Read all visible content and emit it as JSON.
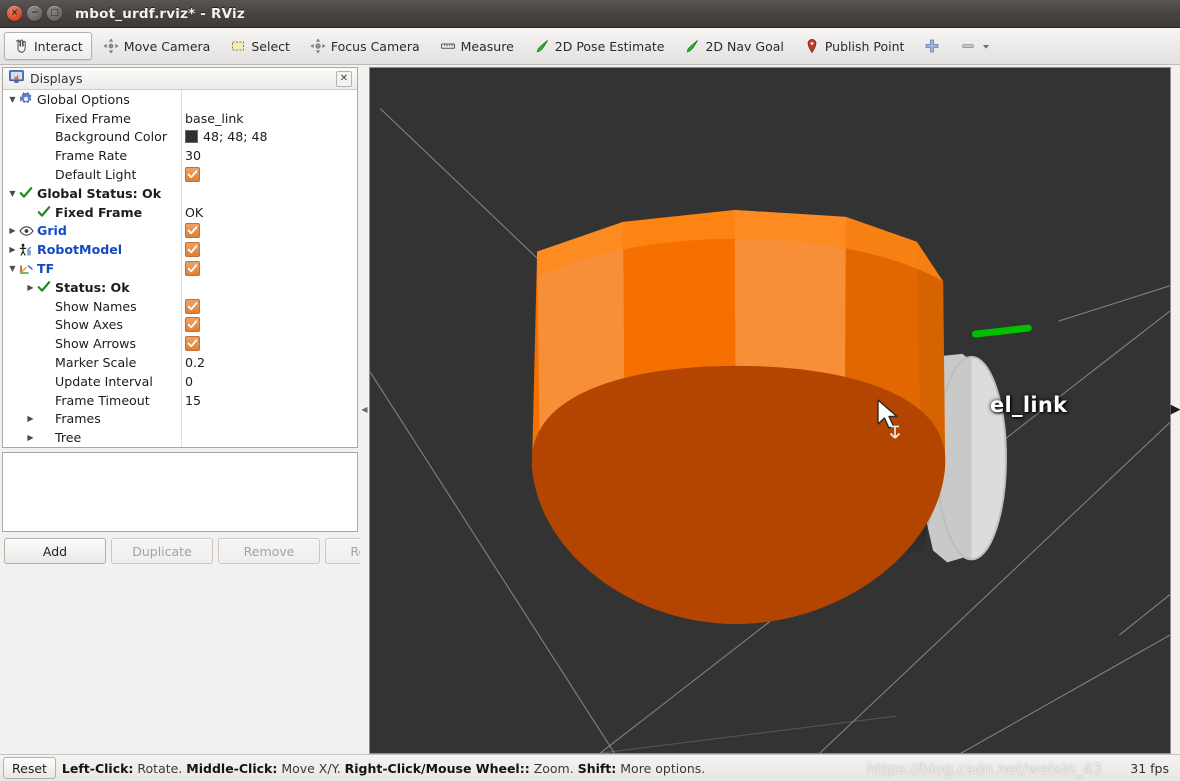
{
  "window": {
    "title": "mbot_urdf.rviz* - RViz",
    "controls": [
      {
        "name": "close",
        "glyph": "×"
      },
      {
        "name": "minimize",
        "glyph": "−"
      },
      {
        "name": "maximize",
        "glyph": "□"
      }
    ]
  },
  "toolbar": {
    "items": [
      {
        "label": "Interact",
        "icon": "hand-cursor-icon",
        "active": true
      },
      {
        "label": "Move Camera",
        "icon": "move-camera-icon",
        "active": false
      },
      {
        "label": "Select",
        "icon": "select-rect-icon",
        "active": false
      },
      {
        "label": "Focus Camera",
        "icon": "focus-camera-icon",
        "active": false
      },
      {
        "label": "Measure",
        "icon": "measure-ruler-icon",
        "active": false
      },
      {
        "label": "2D Pose Estimate",
        "icon": "pose-arrow-icon",
        "active": false
      },
      {
        "label": "2D Nav Goal",
        "icon": "nav-goal-arrow-icon",
        "active": false
      },
      {
        "label": "Publish Point",
        "icon": "map-pin-icon",
        "active": false
      }
    ],
    "add_tool_icon": "plus-icon",
    "remove_tool_icon": "minus-icon",
    "remove_tool_dropdown_icon": "chevron-down-icon"
  },
  "displays": {
    "panel_title": "Displays",
    "panel_icon": "monitor-icon",
    "close_glyph": "✕",
    "rows": [
      {
        "indent": 0,
        "twisty": "down",
        "icon": "gear-icon",
        "label": "Global Options",
        "style": "plain",
        "value_type": "none"
      },
      {
        "indent": 1,
        "twisty": "none",
        "icon": "none",
        "label": "Fixed Frame",
        "style": "plain",
        "value_type": "text",
        "value": "base_link"
      },
      {
        "indent": 1,
        "twisty": "none",
        "icon": "none",
        "label": "Background Color",
        "style": "plain",
        "value_type": "color",
        "value": "48; 48; 48",
        "swatch": "#303030"
      },
      {
        "indent": 1,
        "twisty": "none",
        "icon": "none",
        "label": "Frame Rate",
        "style": "plain",
        "value_type": "text",
        "value": "30"
      },
      {
        "indent": 1,
        "twisty": "none",
        "icon": "none",
        "label": "Default Light",
        "style": "plain",
        "value_type": "checkbox",
        "value": "checked"
      },
      {
        "indent": 0,
        "twisty": "down",
        "icon": "check-icon",
        "label": "Global Status: Ok",
        "style": "bold",
        "value_type": "none"
      },
      {
        "indent": 1,
        "twisty": "none",
        "icon": "check-icon",
        "label": "Fixed Frame",
        "style": "bold",
        "value_type": "text",
        "value": "OK"
      },
      {
        "indent": 0,
        "twisty": "right",
        "icon": "eye-icon",
        "label": "Grid",
        "style": "blue",
        "value_type": "checkbox",
        "value": "checked"
      },
      {
        "indent": 0,
        "twisty": "right",
        "icon": "robot-model-icon",
        "label": "RobotModel",
        "style": "blue",
        "value_type": "checkbox",
        "value": "checked"
      },
      {
        "indent": 0,
        "twisty": "down",
        "icon": "tf-axes-icon",
        "label": "TF",
        "style": "blue",
        "value_type": "checkbox",
        "value": "checked"
      },
      {
        "indent": 1,
        "twisty": "right",
        "icon": "check-icon",
        "label": "Status: Ok",
        "style": "bold",
        "value_type": "none"
      },
      {
        "indent": 1,
        "twisty": "none",
        "icon": "none",
        "label": "Show Names",
        "style": "plain",
        "value_type": "checkbox",
        "value": "checked"
      },
      {
        "indent": 1,
        "twisty": "none",
        "icon": "none",
        "label": "Show Axes",
        "style": "plain",
        "value_type": "checkbox",
        "value": "checked"
      },
      {
        "indent": 1,
        "twisty": "none",
        "icon": "none",
        "label": "Show Arrows",
        "style": "plain",
        "value_type": "checkbox",
        "value": "checked"
      },
      {
        "indent": 1,
        "twisty": "none",
        "icon": "none",
        "label": "Marker Scale",
        "style": "plain",
        "value_type": "text",
        "value": "0.2"
      },
      {
        "indent": 1,
        "twisty": "none",
        "icon": "none",
        "label": "Update Interval",
        "style": "plain",
        "value_type": "text",
        "value": "0"
      },
      {
        "indent": 1,
        "twisty": "none",
        "icon": "none",
        "label": "Frame Timeout",
        "style": "plain",
        "value_type": "text",
        "value": "15"
      },
      {
        "indent": 1,
        "twisty": "right",
        "icon": "none",
        "label": "Frames",
        "style": "plain",
        "value_type": "none"
      },
      {
        "indent": 1,
        "twisty": "right",
        "icon": "none",
        "label": "Tree",
        "style": "plain",
        "value_type": "none"
      }
    ],
    "buttons": [
      {
        "label": "Add",
        "enabled": true
      },
      {
        "label": "Duplicate",
        "enabled": false
      },
      {
        "label": "Remove",
        "enabled": false
      },
      {
        "label": "Rename",
        "enabled": false
      }
    ]
  },
  "view3d": {
    "background_color": "#333333",
    "grid_color": "#b9b9b9",
    "robot_body_color": "#f57000",
    "robot_body_shadow_color": "#b44500",
    "wheel_color": "#d6d6d6",
    "tf_label": "el_link",
    "tf_axis_color": "#00c000",
    "cursor_icon": "arrow-cursor-icon",
    "splitter_left_icon": "collapse-left-icon",
    "splitter_right_icon": "collapse-right-icon"
  },
  "statusbar": {
    "reset_label": "Reset",
    "hint_segments": [
      {
        "text": "Left-Click:",
        "bold": true
      },
      {
        "text": " Rotate. ",
        "bold": false
      },
      {
        "text": "Middle-Click:",
        "bold": true
      },
      {
        "text": " Move X/Y. ",
        "bold": false
      },
      {
        "text": "Right-Click/Mouse Wheel::",
        "bold": true
      },
      {
        "text": " Zoom. ",
        "bold": false
      },
      {
        "text": "Shift:",
        "bold": true
      },
      {
        "text": " More options.",
        "bold": false
      }
    ],
    "fps": "31 fps",
    "watermark": "https://blog.csdn.net/weixin_43"
  }
}
